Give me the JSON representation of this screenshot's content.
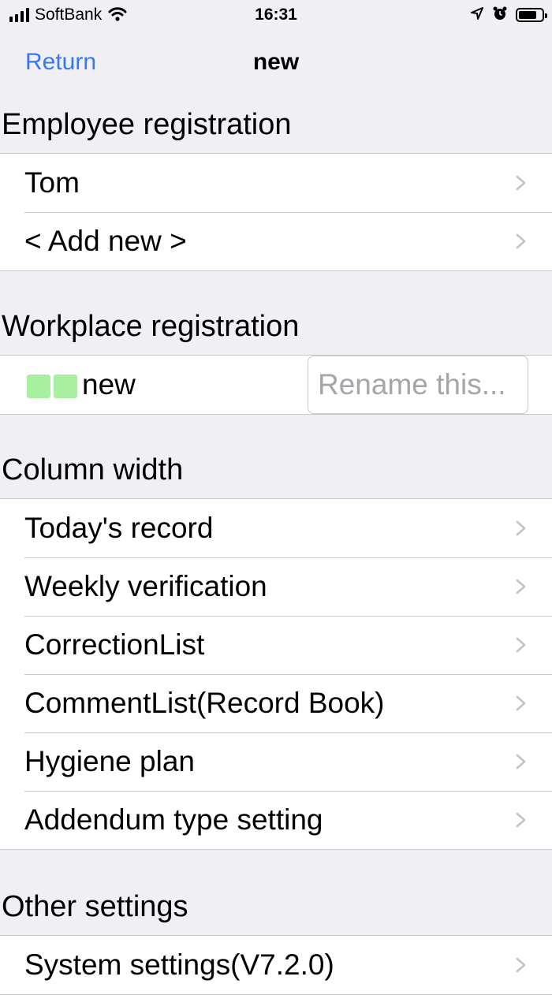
{
  "status_bar": {
    "carrier": "SoftBank",
    "time": "16:31",
    "battery_level": 0.8
  },
  "nav": {
    "back_label": "Return",
    "title": "new"
  },
  "employee_section": {
    "header": "Employee registration",
    "items": [
      {
        "label": "Tom"
      },
      {
        "label": "< Add new >"
      }
    ]
  },
  "workplace_section": {
    "header": "Workplace registration",
    "workplace_name": "new",
    "swatch_color": "#a8f0a0",
    "rename_placeholder": "Rename this..."
  },
  "column_section": {
    "header": "Column width",
    "items": [
      {
        "label": "Today's record"
      },
      {
        "label": "Weekly verification"
      },
      {
        "label": "CorrectionList"
      },
      {
        "label": "CommentList(Record Book)"
      },
      {
        "label": "Hygiene plan"
      },
      {
        "label": "Addendum type setting"
      }
    ]
  },
  "other_section": {
    "header": "Other settings",
    "items": [
      {
        "label": "System settings(V7.2.0)"
      }
    ]
  },
  "colors": {
    "accent": "#3478f6",
    "background": "#efeff4"
  }
}
